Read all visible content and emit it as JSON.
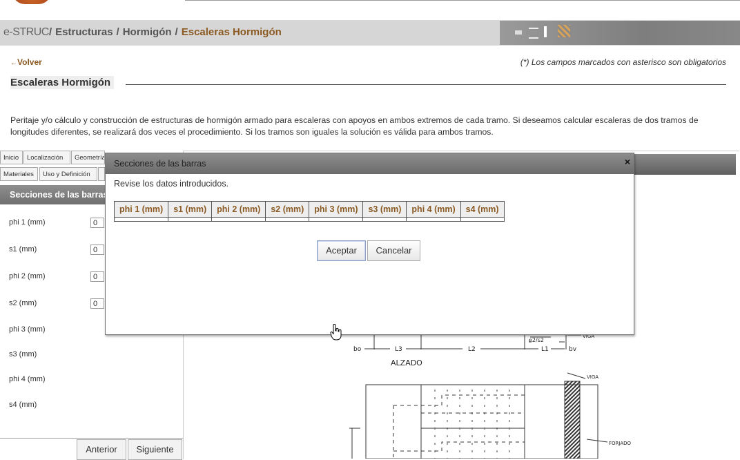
{
  "header": {
    "brand": "e-STRUC",
    "breadcrumb": [
      "Estructuras",
      "Hormigón",
      "Escaleras Hormigón"
    ]
  },
  "page": {
    "back_link": "Volver",
    "required_note": "(*) Los campos marcados con asterisco son obligatorios",
    "title": "Escaleras Hormigón",
    "description": "Peritaje y/o cálculo y construcción de estructuras de hormigón armado para escaleras con apoyos en ambos extremos de cada tramo. Si deseamos calcular escaleras de dos tramos de longitudes diferentes, se realizará dos veces el procedimiento. Si los tramos son iguales la solución es válida para ambos tramos."
  },
  "tabs": {
    "row1": [
      "Inicio",
      "Localización",
      "Geometría"
    ],
    "row2": [
      "Materiales",
      "Uso y Definición"
    ]
  },
  "panel": {
    "title": "Secciones de las barras",
    "fields": [
      {
        "label": "phi 1 (mm)",
        "value": "0"
      },
      {
        "label": "s1 (mm)",
        "value": "0"
      },
      {
        "label": "phi 2 (mm)",
        "value": "0"
      },
      {
        "label": "s2 (mm)",
        "value": "0"
      },
      {
        "label": "phi 3 (mm)",
        "value": ""
      },
      {
        "label": "s3 (mm)",
        "value": ""
      },
      {
        "label": "phi 4 (mm)",
        "value": ""
      },
      {
        "label": "s4 (mm)",
        "value": ""
      }
    ],
    "prev_label": "Anterior",
    "next_label": "Siguiente"
  },
  "modal": {
    "title": "Secciones de las barras",
    "close": "×",
    "message": "Revise los datos introducidos.",
    "columns": [
      "phi 1 (mm)",
      "s1 (mm)",
      "phi 2 (mm)",
      "s2 (mm)",
      "phi 3 (mm)",
      "s3 (mm)",
      "phi 4 (mm)",
      "s4 (mm)"
    ],
    "accept_label": "Aceptar",
    "cancel_label": "Cancelar"
  },
  "drawing": {
    "labels": {
      "bo": "bo",
      "l3": "L3",
      "l2": "L2",
      "l1": "L1",
      "bv": "bv",
      "alzado": "ALZADO",
      "viga_top": "VIGA",
      "viga": "VIGA",
      "forjado": "FORJADO",
      "e2s2": "e2/s2"
    }
  }
}
